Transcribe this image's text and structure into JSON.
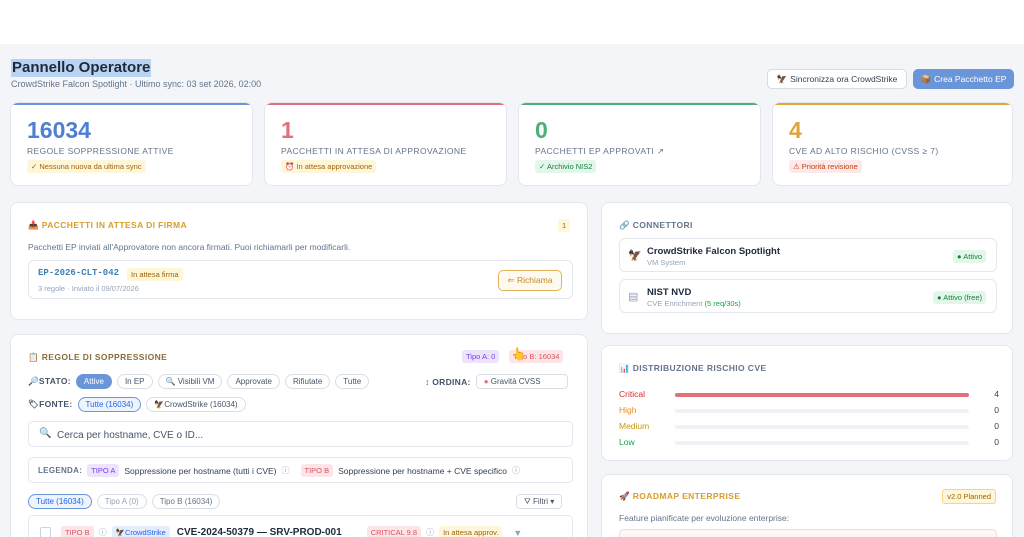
{
  "header": {
    "title": "Pannello Operatore",
    "subtitle": "CrowdStrike Falcon Spotlight · Ultimo sync: 03 set 2026, 02:00",
    "sync_button": "Sincronizza ora CrowdStrike",
    "create_button": "Crea Pacchetto EP"
  },
  "stats": [
    {
      "value": "16034",
      "label": "REGOLE SOPPRESSIONE ATTIVE",
      "badge": "✓ Nessuna nuova da ultima sync",
      "color": "#4f7fd1"
    },
    {
      "value": "1",
      "label": "PACCHETTI IN ATTESA DI APPROVAZIONE",
      "badge": "⏰ In attesa approvazione",
      "color": "#e0707a"
    },
    {
      "value": "0",
      "label": "PACCHETTI EP APPROVATI ↗",
      "badge": "✓ Archivio NIS2",
      "color": "#4caf7a"
    },
    {
      "value": "4",
      "label": "CVE AD ALTO RISCHIO (CVSS ≥ 7)",
      "badge": "⚠ Priorità revisione",
      "color": "#e0a53a"
    }
  ],
  "pending": {
    "title": "PACCHETTI IN ATTESA DI FIRMA",
    "count": "1",
    "desc": "Pacchetti EP inviati all'Approvatore non ancora firmati. Puoi richiamarli per modificarli.",
    "item_id": "EP-2026-CLT-042",
    "item_status": "In attesa firma",
    "item_meta": "3 regole · Inviato il 09/07/2026",
    "recall_button": "⇐ Richiama"
  },
  "rules": {
    "title": "REGOLE DI SOPPRESSIONE",
    "type_a_badge": "Tipo A: 0",
    "type_b_badge": "Tipo B: 16034",
    "stato_label": "STATO:",
    "stato_filters": [
      "Attive",
      "In EP",
      "Visibili VM",
      "Approvate",
      "Rifiutate",
      "Tutte"
    ],
    "ordina_label": "ORDINA:",
    "ordina_value": "Gravità CVSS",
    "fonte_label": "FONTE:",
    "fonte_filters": [
      "Tutte (16034)",
      "CrowdStrike (16034)"
    ],
    "search_placeholder": "Cerca per hostname, CVE o ID...",
    "legend_label": "LEGENDA:",
    "legend_a_tag": "TIPO A",
    "legend_a_text": "Soppressione per hostname (tutti i CVE)",
    "legend_b_tag": "TIPO B",
    "legend_b_text": "Soppressione per hostname + CVE specifico",
    "tabs": [
      "Tutte (16034)",
      "Tipo A (0)",
      "Tipo B (16034)"
    ],
    "filters_button": "Filtri ▾",
    "row": {
      "type": "TIPO B",
      "source": "CrowdStrike",
      "title": "CVE-2024-50379 — SRV-PROD-001",
      "severity": "CRITICAL 9.8",
      "status": "In attesa approv."
    }
  },
  "connectors": {
    "title": "CONNETTORI",
    "items": [
      {
        "name": "CrowdStrike Falcon Spotlight",
        "sub": "VM System",
        "status": "● Attivo",
        "icon": "falcon-icon"
      },
      {
        "name": "NIST NVD",
        "sub": "CVE Enrichment",
        "sub_extra": "(5 req/30s)",
        "status": "● Attivo (free)",
        "icon": "document-icon"
      }
    ]
  },
  "distribution": {
    "title": "DISTRIBUZIONE RISCHIO CVE",
    "rows": [
      {
        "label": "Critical",
        "value": 4,
        "fraction": 1.0,
        "color": "#e0707a",
        "label_color": "#dc2626"
      },
      {
        "label": "High",
        "value": 0,
        "fraction": 0,
        "color": "#f59e0b",
        "label_color": "#ea8a1a"
      },
      {
        "label": "Medium",
        "value": 0,
        "fraction": 0,
        "color": "#eab308",
        "label_color": "#c99a06"
      },
      {
        "label": "Low",
        "value": 0,
        "fraction": 0,
        "color": "#22c55e",
        "label_color": "#16a34a"
      }
    ]
  },
  "roadmap": {
    "title": "ROADMAP ENTERPRISE",
    "version": "v2.0 Planned",
    "desc": "Feature pianificate per evoluzione enterprise:"
  }
}
